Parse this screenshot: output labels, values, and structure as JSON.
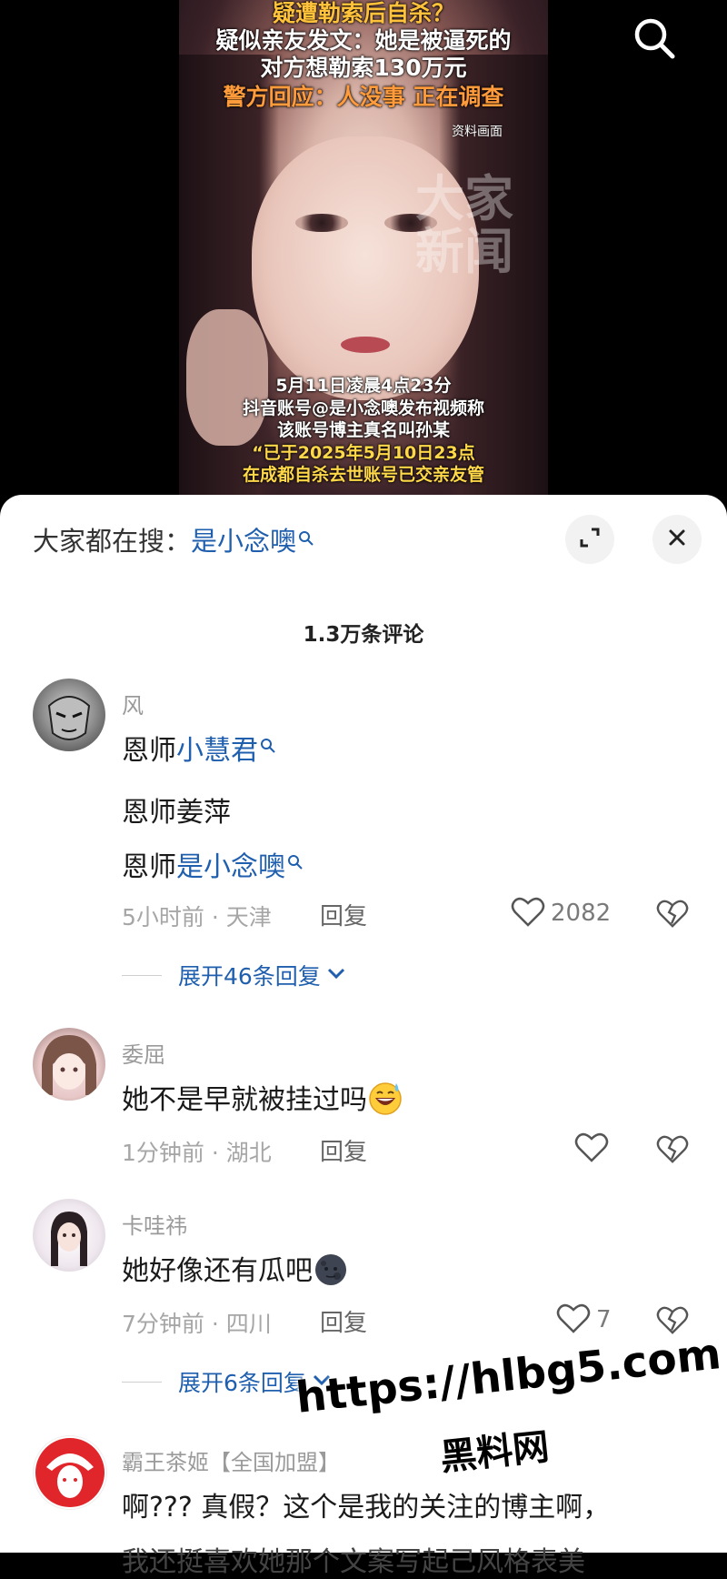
{
  "video": {
    "headline_1": "疑遭勒索后自杀？",
    "headline_2": "疑似亲友发文：她是被逼死的",
    "headline_3": "对方想勒索130万元",
    "headline_4": "警方回应：人没事 正在调查",
    "source_label": "资料画面",
    "caption_1": "5月11日凌晨4点23分",
    "caption_2": "抖音账号@是小念噢发布视频称",
    "caption_3": "该账号博主真名叫孙某",
    "caption_4": "“已于2025年5月10日23点",
    "caption_5": "在成都自杀去世账号已交亲友管",
    "search_icon": "search-icon"
  },
  "sheet": {
    "trending_label": "大家都在搜：",
    "trending_keyword": "是小念噢",
    "expand_icon": "expand-icon",
    "close_icon": "close-icon",
    "comment_count": "1.3万条评论"
  },
  "comments": [
    {
      "username": "风",
      "lines": [
        {
          "prefix": "恩师",
          "keyword": "小慧君"
        },
        {
          "prefix": "恩师姜萍",
          "keyword": ""
        },
        {
          "prefix": "恩师",
          "keyword": "是小念噢"
        }
      ],
      "meta": "5小时前 · 天津",
      "reply_label": "回复",
      "likes": "2082",
      "expand_label": "展开46条回复"
    },
    {
      "username": "委屈",
      "text": "她不是早就被挂过吗",
      "emoji": "grinning-sweat-emoji",
      "meta": "1分钟前 · 湖北",
      "reply_label": "回复",
      "likes": ""
    },
    {
      "username": "卡哇祎",
      "text": "她好像还有瓜吧",
      "emoji": "new-moon-face-emoji",
      "meta": "7分钟前 · 四川",
      "reply_label": "回复",
      "likes": "7",
      "expand_label": "展开6条回复"
    },
    {
      "username": "霸王茶姬【全国加盟】",
      "text": "啊??? 真假？这个是我的关注的博主啊，",
      "text_partial": "我还挺喜欢她那个文案写起己风格表美"
    }
  ],
  "watermark": {
    "url": "https://hlbg5.com",
    "name": "黑料网"
  },
  "colors": {
    "link_blue": "#1f5fae",
    "headline_yellow": "#ffc23a",
    "headline_orange": "#ff9b3a"
  }
}
